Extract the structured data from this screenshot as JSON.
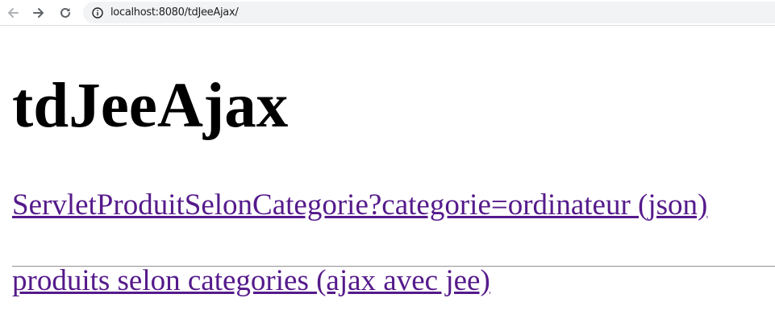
{
  "browser": {
    "url": "localhost:8080/tdJeeAjax/",
    "icons": {
      "back": "arrow-left-icon",
      "forward": "arrow-right-icon",
      "reload": "reload-icon",
      "site_info": "info-icon"
    }
  },
  "page": {
    "title": "tdJeeAjax",
    "links": [
      "ServletProduitSelonCategorie?categorie=ordinateur (json)",
      "produits selon categories (ajax avec jee)"
    ]
  },
  "colors": {
    "visited_link": "#551a8b",
    "address_bar_bg": "#f1f3f4",
    "nav_icon_back": "#b0b3b8",
    "nav_icon": "#5f6368"
  }
}
